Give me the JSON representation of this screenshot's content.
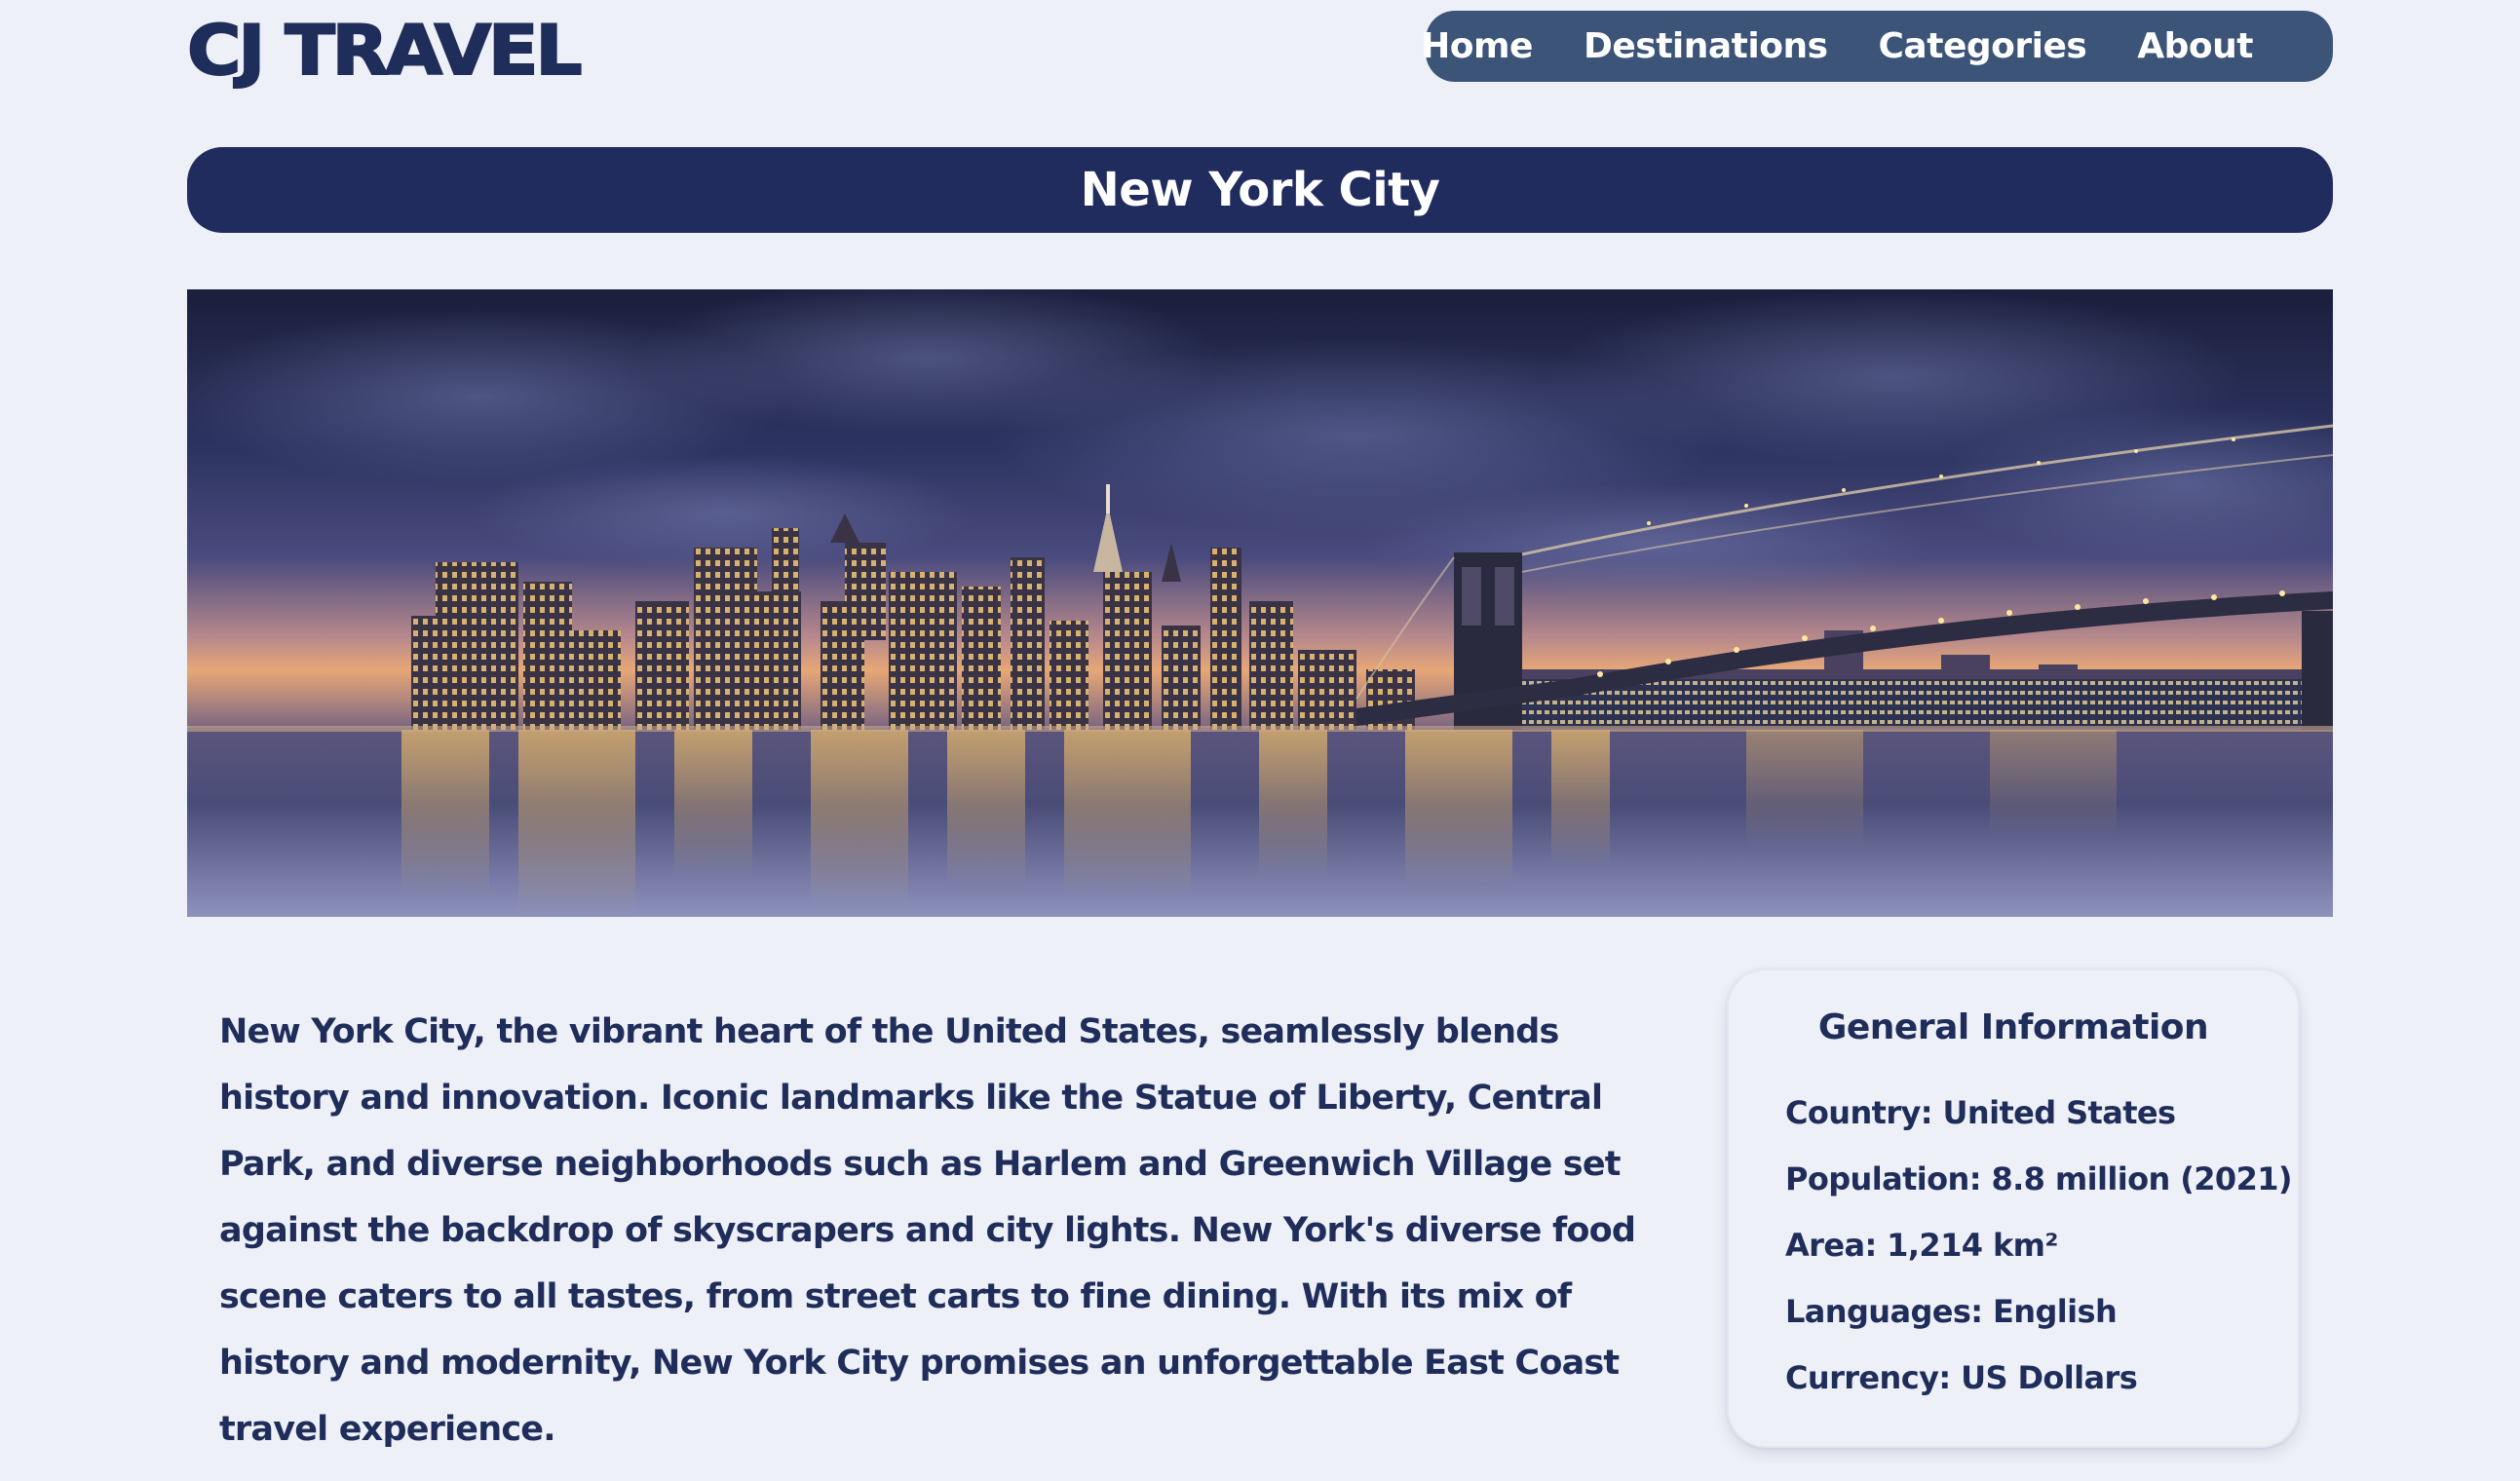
{
  "brand": {
    "logo_text": "CJ TRAVEL"
  },
  "nav": {
    "items": [
      {
        "label": "Home"
      },
      {
        "label": "Destinations"
      },
      {
        "label": "Categories"
      },
      {
        "label": "About"
      }
    ]
  },
  "page": {
    "title": "New York City"
  },
  "hero": {
    "image_subject": "New York City skyline at dusk with Brooklyn Bridge reflected in water"
  },
  "description": "New York City, the vibrant heart of the United States, seamlessly blends history and innovation. Iconic landmarks like the Statue of Liberty, Central Park, and diverse neighborhoods such as Harlem and Greenwich Village set against the backdrop of skyscrapers and city lights. New York's diverse food scene caters to all tastes, from street carts to fine dining. With its mix of history and modernity, New York City promises an unforgettable East Coast travel experience.",
  "info": {
    "heading": "General Information",
    "items": [
      "Country: United States",
      "Population: 8.8 million (2021)",
      "Area: 1,214 km²",
      "Languages: English",
      "Currency: US Dollars"
    ]
  },
  "colors": {
    "background": "#eef0f7",
    "navy": "#202c5e",
    "nav_bar": "#3b5478",
    "text": "#1f2d5a"
  }
}
